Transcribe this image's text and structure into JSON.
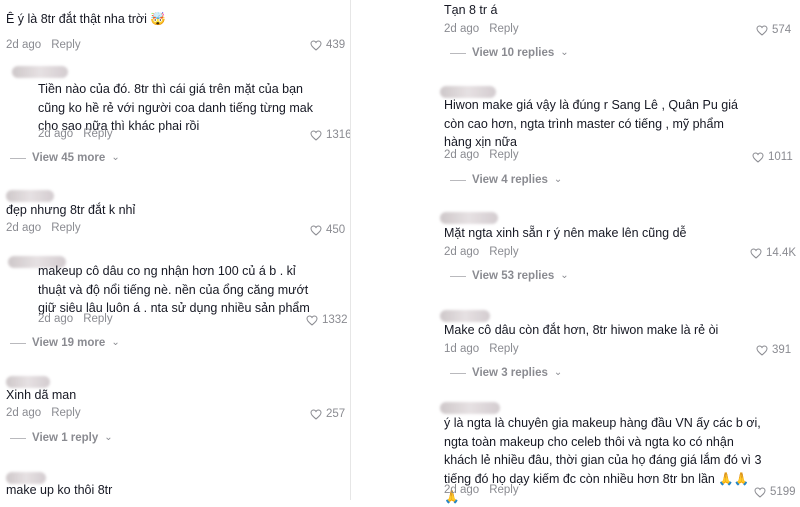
{
  "left": {
    "c1": {
      "text": "Ê ý là 8tr đắt thật nha trời 🤯",
      "time": "2d ago",
      "reply": "Reply",
      "likes": "439"
    },
    "r1": {
      "text": "Tiền nào của đó. 8tr thì cái giá trên mặt của bạn cũng ko hề rẻ với người coa danh tiếng từng mak cho sao nữa thì khác phai rồi",
      "time": "2d ago",
      "reply": "Reply",
      "likes": "1316"
    },
    "v1": "View 45 more",
    "c2": {
      "text": "đẹp nhưng 8tr đắt k nhỉ",
      "time": "2d ago",
      "reply": "Reply",
      "likes": "450"
    },
    "r2": {
      "text": "makeup cô dâu co ng nhận hơn 100 củ á b . kỉ thuật và độ nổi tiếng nè. nền của ổng căng mướt giữ siêu lâu luôn á . nta sử dụng nhiều sản phẩm",
      "time": "2d ago",
      "reply": "Reply",
      "likes": "1332"
    },
    "v2": "View 19 more",
    "c3": {
      "text": "Xinh dã man",
      "time": "2d ago",
      "reply": "Reply",
      "likes": "257"
    },
    "v3": "View 1 reply",
    "c4": {
      "text": "make up ko thôi 8tr"
    }
  },
  "right": {
    "c0": {
      "text": "Tạn 8 tr á",
      "time": "2d ago",
      "reply": "Reply",
      "likes": "574"
    },
    "v0": "View 10 replies",
    "c1": {
      "text": "Hiwon make giá vậy là đúng r Sang Lê , Quân Pu giá còn cao hơn, ngta trình master có tiếng , mỹ phẩm hàng xịn nữa",
      "time": "2d ago",
      "reply": "Reply",
      "likes": "1011"
    },
    "v1": "View 4 replies",
    "c2": {
      "text": "Mặt ngta xinh sẵn r ý nên make lên cũng dễ",
      "time": "2d ago",
      "reply": "Reply",
      "likes": "14.4K"
    },
    "v2": "View 53 replies",
    "c3": {
      "text": "Make cô dâu còn đắt hơn, 8tr hiwon make là rẻ òi",
      "time": "1d ago",
      "reply": "Reply",
      "likes": "391"
    },
    "v3": "View 3 replies",
    "c4": {
      "text": "ý là ngta là chuyên gia makeup hàng đầu VN ấy các b ơi, ngta toàn makeup cho celeb thôi và ngta ko có nhận khách lẻ nhiều đâu, thời gian của họ đáng giá lắm đó vì 3 tiếng đó họ dạy kiếm đc còn nhiều hơn 8tr bn lần",
      "emoji": "🙏🙏🙏",
      "time": "2d ago",
      "reply": "Reply",
      "likes": "5199"
    }
  }
}
